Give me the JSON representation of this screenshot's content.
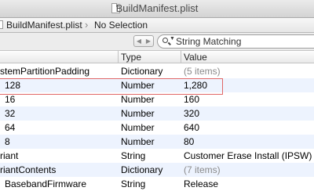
{
  "window": {
    "title": "BuildManifest.plist"
  },
  "jumpbar": {
    "file": "BuildManifest.plist",
    "separator": "›",
    "selection": "No Selection"
  },
  "toolbar": {
    "back_glyph": "◀",
    "forward_glyph": "▶",
    "search_placeholder": "String Matching",
    "search_icon": "magnifier-icon"
  },
  "table": {
    "columns": [
      {
        "label": "Type"
      },
      {
        "label": "Value"
      }
    ],
    "rows": [
      {
        "key": "stemPartitionPadding",
        "type": "Dictionary",
        "value": "(5 items)"
      },
      {
        "key": "128",
        "type": "Number",
        "value": "1,280"
      },
      {
        "key": "16",
        "type": "Number",
        "value": "160"
      },
      {
        "key": "32",
        "type": "Number",
        "value": "320"
      },
      {
        "key": "64",
        "type": "Number",
        "value": "640"
      },
      {
        "key": "8",
        "type": "Number",
        "value": "80"
      },
      {
        "key": "riant",
        "type": "String",
        "value": "Customer Erase Install (IPSW)"
      },
      {
        "key": "riantContents",
        "type": "Dictionary",
        "value": "(7 items)"
      },
      {
        "key": "BasebandFirmware",
        "type": "String",
        "value": "Release"
      }
    ]
  },
  "colors": {
    "highlight": "#e06666",
    "alt_row": "#edf3fe",
    "dim_text": "#8a8a8a"
  }
}
